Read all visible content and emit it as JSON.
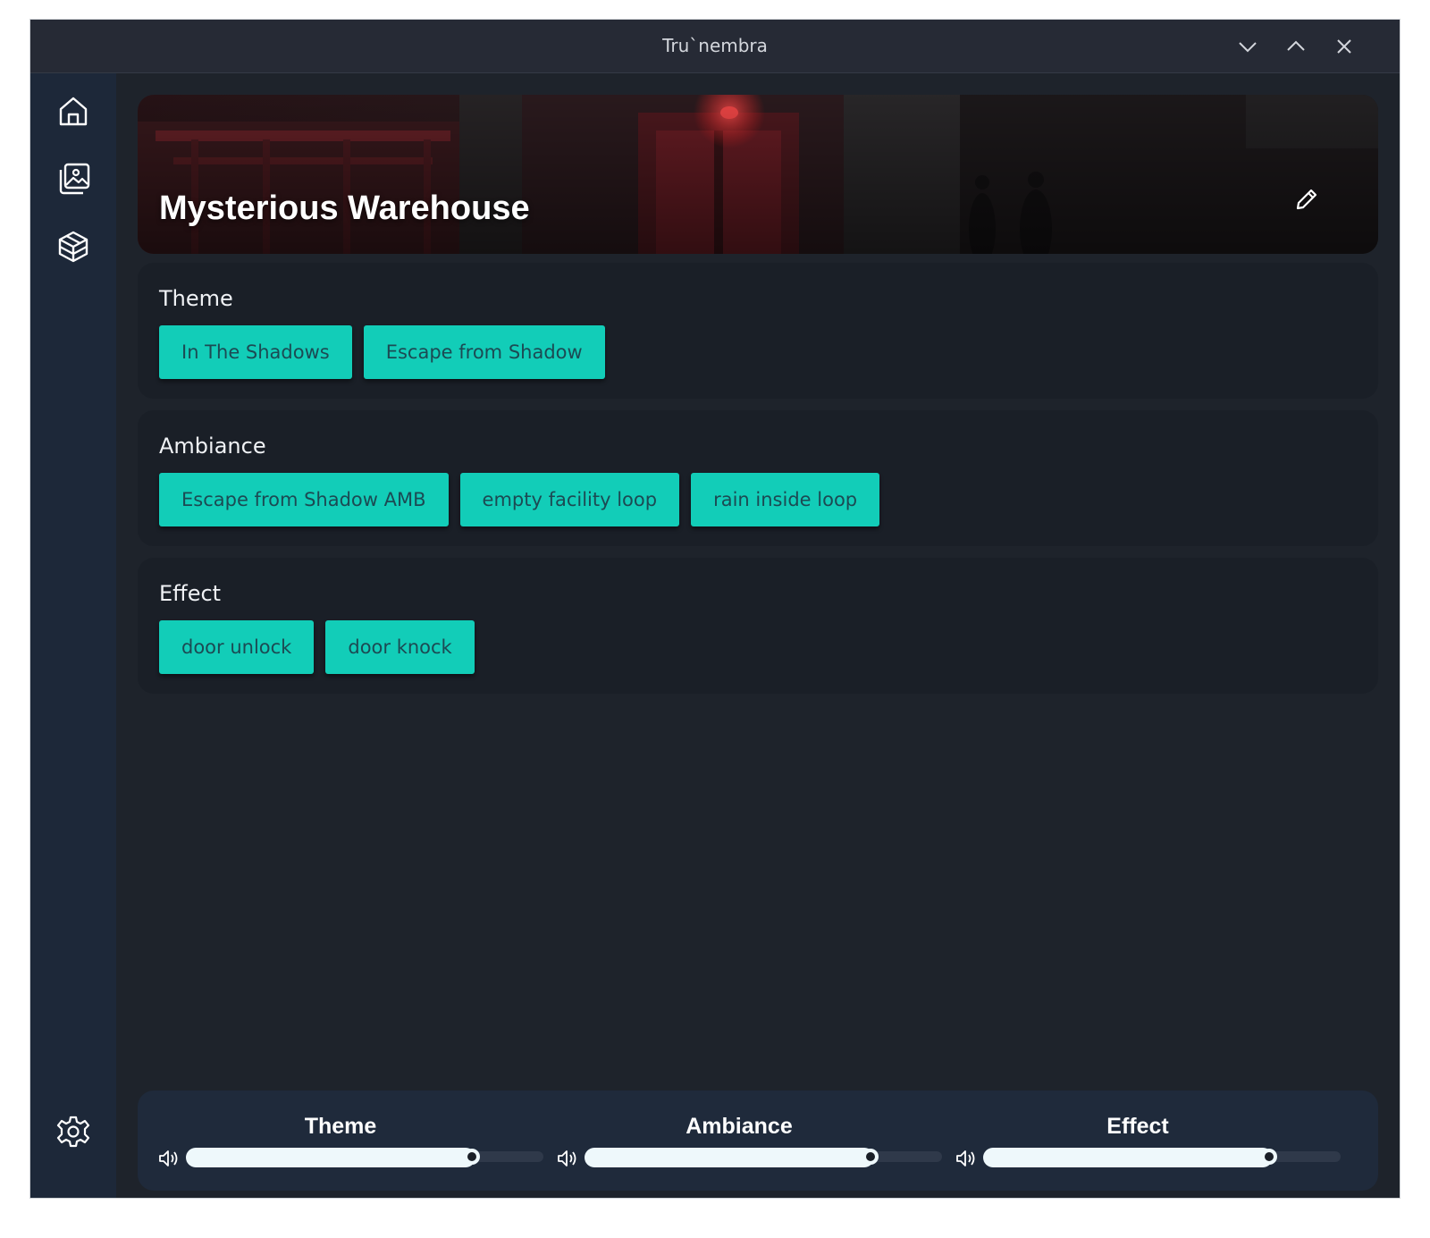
{
  "window": {
    "title": "Tru`nembra"
  },
  "sidebar": {
    "items": [
      {
        "icon": "home-icon"
      },
      {
        "icon": "gallery-icon"
      },
      {
        "icon": "package-icon"
      },
      {
        "icon": "settings-icon"
      }
    ]
  },
  "scene": {
    "title": "Mysterious Warehouse"
  },
  "sections": {
    "theme": {
      "title": "Theme",
      "tracks": [
        "In The Shadows",
        "Escape from Shadow"
      ]
    },
    "ambiance": {
      "title": "Ambiance",
      "tracks": [
        "Escape from Shadow AMB",
        "empty facility loop",
        "rain inside loop"
      ]
    },
    "effect": {
      "title": "Effect",
      "tracks": [
        "door unlock",
        "door knock"
      ]
    }
  },
  "mixer": {
    "theme": {
      "label": "Theme",
      "volume": 0.8
    },
    "ambiance": {
      "label": "Ambiance",
      "volume": 0.8
    },
    "effect": {
      "label": "Effect",
      "volume": 0.8
    }
  },
  "colors": {
    "accent": "#12cdb8",
    "chip_text": "#1c4a53",
    "background": "#1e232b",
    "sidebar": "#1d2839"
  }
}
